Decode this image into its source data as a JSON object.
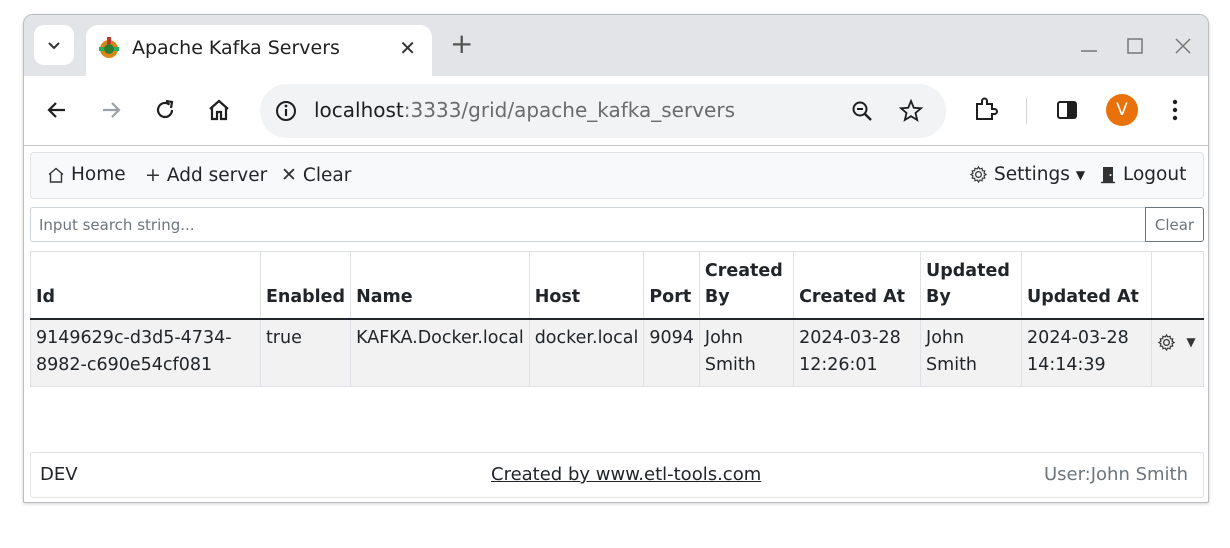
{
  "browser": {
    "tab_title": "Apache Kafka Servers",
    "url_host": "localhost",
    "url_path": ":3333/grid/apache_kafka_servers",
    "profile_initial": "V",
    "accent_color": "#e8710a"
  },
  "nav": {
    "home": "Home",
    "add_server": "Add server",
    "clear": "Clear",
    "settings": "Settings",
    "logout": "Logout"
  },
  "search": {
    "placeholder": "Input search string...",
    "clear_label": "Clear"
  },
  "table": {
    "headers": {
      "id": "Id",
      "enabled": "Enabled",
      "name": "Name",
      "host": "Host",
      "port": "Port",
      "created_by": "Created By",
      "created_at": "Created At",
      "updated_by": "Updated By",
      "updated_at": "Updated At"
    },
    "rows": [
      {
        "id": "9149629c-d3d5-4734-8982-c690e54cf081",
        "enabled": "true",
        "name": "KAFKA.Docker.local",
        "host": "docker.local",
        "port": "9094",
        "created_by": "John Smith",
        "created_at": "2024-03-28 12:26:01",
        "updated_by": "John Smith",
        "updated_at": "2024-03-28 14:14:39"
      }
    ]
  },
  "footer": {
    "env": "DEV",
    "credit": "Created by www.etl-tools.com",
    "user": "User:John Smith"
  }
}
